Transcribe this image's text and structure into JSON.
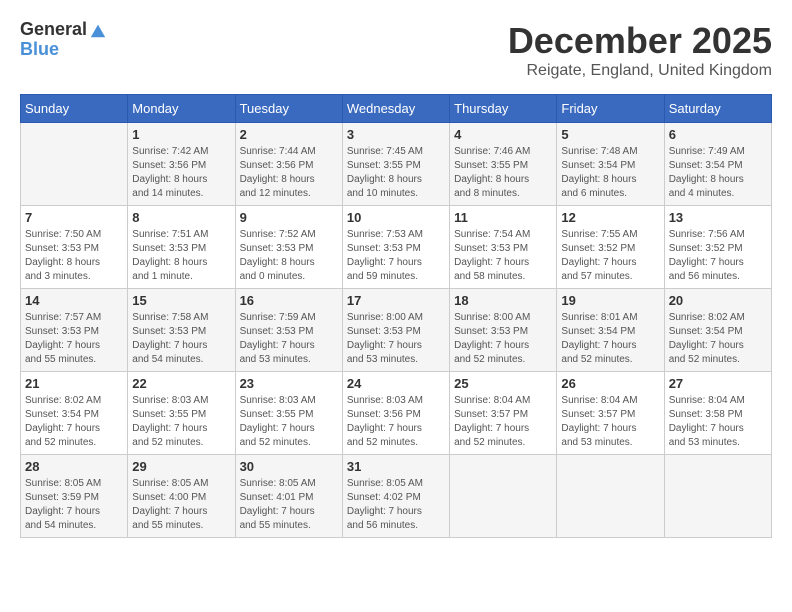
{
  "logo": {
    "line1": "General",
    "line2": "Blue"
  },
  "title": "December 2025",
  "subtitle": "Reigate, England, United Kingdom",
  "weekdays": [
    "Sunday",
    "Monday",
    "Tuesday",
    "Wednesday",
    "Thursday",
    "Friday",
    "Saturday"
  ],
  "weeks": [
    [
      {
        "day": "",
        "info": ""
      },
      {
        "day": "1",
        "info": "Sunrise: 7:42 AM\nSunset: 3:56 PM\nDaylight: 8 hours\nand 14 minutes."
      },
      {
        "day": "2",
        "info": "Sunrise: 7:44 AM\nSunset: 3:56 PM\nDaylight: 8 hours\nand 12 minutes."
      },
      {
        "day": "3",
        "info": "Sunrise: 7:45 AM\nSunset: 3:55 PM\nDaylight: 8 hours\nand 10 minutes."
      },
      {
        "day": "4",
        "info": "Sunrise: 7:46 AM\nSunset: 3:55 PM\nDaylight: 8 hours\nand 8 minutes."
      },
      {
        "day": "5",
        "info": "Sunrise: 7:48 AM\nSunset: 3:54 PM\nDaylight: 8 hours\nand 6 minutes."
      },
      {
        "day": "6",
        "info": "Sunrise: 7:49 AM\nSunset: 3:54 PM\nDaylight: 8 hours\nand 4 minutes."
      }
    ],
    [
      {
        "day": "7",
        "info": "Sunrise: 7:50 AM\nSunset: 3:53 PM\nDaylight: 8 hours\nand 3 minutes."
      },
      {
        "day": "8",
        "info": "Sunrise: 7:51 AM\nSunset: 3:53 PM\nDaylight: 8 hours\nand 1 minute."
      },
      {
        "day": "9",
        "info": "Sunrise: 7:52 AM\nSunset: 3:53 PM\nDaylight: 8 hours\nand 0 minutes."
      },
      {
        "day": "10",
        "info": "Sunrise: 7:53 AM\nSunset: 3:53 PM\nDaylight: 7 hours\nand 59 minutes."
      },
      {
        "day": "11",
        "info": "Sunrise: 7:54 AM\nSunset: 3:53 PM\nDaylight: 7 hours\nand 58 minutes."
      },
      {
        "day": "12",
        "info": "Sunrise: 7:55 AM\nSunset: 3:52 PM\nDaylight: 7 hours\nand 57 minutes."
      },
      {
        "day": "13",
        "info": "Sunrise: 7:56 AM\nSunset: 3:52 PM\nDaylight: 7 hours\nand 56 minutes."
      }
    ],
    [
      {
        "day": "14",
        "info": "Sunrise: 7:57 AM\nSunset: 3:53 PM\nDaylight: 7 hours\nand 55 minutes."
      },
      {
        "day": "15",
        "info": "Sunrise: 7:58 AM\nSunset: 3:53 PM\nDaylight: 7 hours\nand 54 minutes."
      },
      {
        "day": "16",
        "info": "Sunrise: 7:59 AM\nSunset: 3:53 PM\nDaylight: 7 hours\nand 53 minutes."
      },
      {
        "day": "17",
        "info": "Sunrise: 8:00 AM\nSunset: 3:53 PM\nDaylight: 7 hours\nand 53 minutes."
      },
      {
        "day": "18",
        "info": "Sunrise: 8:00 AM\nSunset: 3:53 PM\nDaylight: 7 hours\nand 52 minutes."
      },
      {
        "day": "19",
        "info": "Sunrise: 8:01 AM\nSunset: 3:54 PM\nDaylight: 7 hours\nand 52 minutes."
      },
      {
        "day": "20",
        "info": "Sunrise: 8:02 AM\nSunset: 3:54 PM\nDaylight: 7 hours\nand 52 minutes."
      }
    ],
    [
      {
        "day": "21",
        "info": "Sunrise: 8:02 AM\nSunset: 3:54 PM\nDaylight: 7 hours\nand 52 minutes."
      },
      {
        "day": "22",
        "info": "Sunrise: 8:03 AM\nSunset: 3:55 PM\nDaylight: 7 hours\nand 52 minutes."
      },
      {
        "day": "23",
        "info": "Sunrise: 8:03 AM\nSunset: 3:55 PM\nDaylight: 7 hours\nand 52 minutes."
      },
      {
        "day": "24",
        "info": "Sunrise: 8:03 AM\nSunset: 3:56 PM\nDaylight: 7 hours\nand 52 minutes."
      },
      {
        "day": "25",
        "info": "Sunrise: 8:04 AM\nSunset: 3:57 PM\nDaylight: 7 hours\nand 52 minutes."
      },
      {
        "day": "26",
        "info": "Sunrise: 8:04 AM\nSunset: 3:57 PM\nDaylight: 7 hours\nand 53 minutes."
      },
      {
        "day": "27",
        "info": "Sunrise: 8:04 AM\nSunset: 3:58 PM\nDaylight: 7 hours\nand 53 minutes."
      }
    ],
    [
      {
        "day": "28",
        "info": "Sunrise: 8:05 AM\nSunset: 3:59 PM\nDaylight: 7 hours\nand 54 minutes."
      },
      {
        "day": "29",
        "info": "Sunrise: 8:05 AM\nSunset: 4:00 PM\nDaylight: 7 hours\nand 55 minutes."
      },
      {
        "day": "30",
        "info": "Sunrise: 8:05 AM\nSunset: 4:01 PM\nDaylight: 7 hours\nand 55 minutes."
      },
      {
        "day": "31",
        "info": "Sunrise: 8:05 AM\nSunset: 4:02 PM\nDaylight: 7 hours\nand 56 minutes."
      },
      {
        "day": "",
        "info": ""
      },
      {
        "day": "",
        "info": ""
      },
      {
        "day": "",
        "info": ""
      }
    ]
  ]
}
